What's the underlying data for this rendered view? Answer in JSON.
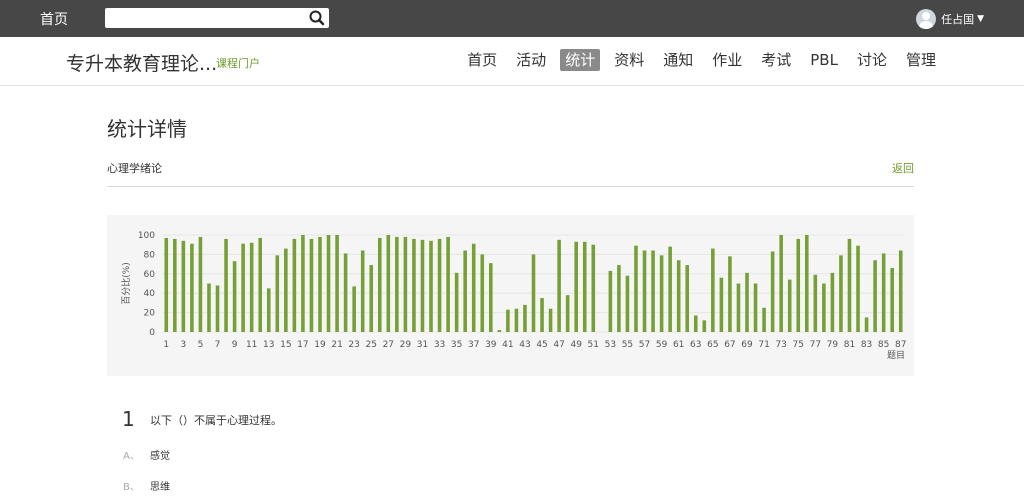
{
  "topbar": {
    "home_label": "首页",
    "search_placeholder": "",
    "user_name": "任占国"
  },
  "course": {
    "title": "专升本教育理论...",
    "portal_link": "课程门户",
    "nav": [
      "首页",
      "活动",
      "统计",
      "资料",
      "通知",
      "作业",
      "考试",
      "PBL",
      "讨论",
      "管理"
    ],
    "active_nav": "统计"
  },
  "page": {
    "title": "统计详情",
    "chapter": "心理学绪论",
    "back_label": "返回"
  },
  "chart_data": {
    "type": "bar",
    "ylabel": "百分比(%)",
    "xlabel": "题目",
    "ylim": [
      0,
      100
    ],
    "yticks": [
      0,
      20,
      40,
      60,
      80,
      100
    ],
    "bar_color": "#76a035",
    "categories": [
      1,
      2,
      3,
      4,
      5,
      6,
      7,
      8,
      9,
      10,
      11,
      12,
      13,
      14,
      15,
      16,
      17,
      18,
      19,
      20,
      21,
      22,
      23,
      24,
      25,
      26,
      27,
      28,
      29,
      30,
      31,
      32,
      33,
      34,
      35,
      36,
      37,
      38,
      39,
      40,
      41,
      42,
      43,
      44,
      45,
      46,
      47,
      48,
      49,
      50,
      51,
      52,
      53,
      54,
      55,
      56,
      57,
      58,
      59,
      60,
      61,
      62,
      63,
      64,
      65,
      66,
      67,
      68,
      69,
      70,
      71,
      72,
      73,
      74,
      75,
      76,
      77,
      78,
      79,
      80,
      81,
      82,
      83,
      84,
      85,
      86,
      87
    ],
    "xtick_labels": [
      "1",
      "3",
      "5",
      "7",
      "9",
      "11",
      "13",
      "15",
      "17",
      "19",
      "21",
      "23",
      "25",
      "27",
      "29",
      "31",
      "33",
      "35",
      "37",
      "39",
      "41",
      "43",
      "45",
      "47",
      "49",
      "51",
      "53",
      "55",
      "57",
      "59",
      "61",
      "63",
      "65",
      "67",
      "69",
      "71",
      "73",
      "75",
      "77",
      "79",
      "81",
      "83",
      "85",
      "87"
    ],
    "values": [
      97,
      96,
      94,
      91,
      98,
      50,
      48,
      96,
      73,
      91,
      92,
      97,
      45,
      79,
      86,
      96,
      100,
      96,
      98,
      100,
      100,
      81,
      47,
      84,
      69,
      97,
      100,
      98,
      98,
      96,
      95,
      94,
      96,
      98,
      61,
      84,
      91,
      80,
      71,
      2,
      23,
      24,
      28,
      80,
      35,
      24,
      95,
      38,
      93,
      93,
      90,
      0,
      63,
      69,
      58,
      89,
      84,
      84,
      79,
      88,
      74,
      69,
      17,
      12,
      86,
      56,
      78,
      50,
      61,
      50,
      25,
      83,
      100,
      54,
      96,
      100,
      59,
      50,
      61,
      79,
      96,
      89,
      15,
      74,
      81,
      66,
      84
    ]
  },
  "question": {
    "number": "1",
    "text": "以下（）不属于心理过程。",
    "options": [
      {
        "letter": "A、",
        "text": "感觉"
      },
      {
        "letter": "B、",
        "text": "思维"
      }
    ]
  }
}
